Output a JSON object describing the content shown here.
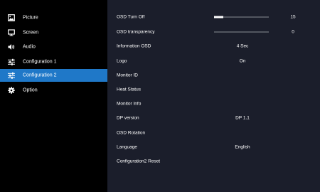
{
  "sidebar": {
    "items": [
      {
        "label": "Picture",
        "icon": "picture-icon",
        "selected": false
      },
      {
        "label": "Screen",
        "icon": "monitor-icon",
        "selected": false
      },
      {
        "label": "Audio",
        "icon": "speaker-icon",
        "selected": false
      },
      {
        "label": "Configuration 1",
        "icon": "sliders-icon",
        "selected": false
      },
      {
        "label": "Configuration 2",
        "icon": "sliders-icon",
        "selected": true
      },
      {
        "label": "Option",
        "icon": "gear-icon",
        "selected": false
      }
    ],
    "selected_color": "#1f78c8"
  },
  "panel": {
    "background": "#1b1e2b",
    "rows": [
      {
        "label": "OSD Turn Off",
        "type": "slider",
        "value": "15",
        "fraction": 0.17
      },
      {
        "label": "OSD transparency",
        "type": "slider",
        "value": "0",
        "fraction": 0
      },
      {
        "label": "Information OSD",
        "type": "value",
        "value": "4 Sec"
      },
      {
        "label": "Logo",
        "type": "value",
        "value": "On"
      },
      {
        "label": "Monitor ID",
        "type": "link",
        "value": ""
      },
      {
        "label": "Heat Status",
        "type": "link",
        "value": ""
      },
      {
        "label": "Monitor Info",
        "type": "link",
        "value": ""
      },
      {
        "label": "DP version",
        "type": "value",
        "value": "DP 1.1"
      },
      {
        "label": "OSD Rotation",
        "type": "link",
        "value": ""
      },
      {
        "label": "Language",
        "type": "value",
        "value": "English"
      },
      {
        "label": "Configuration2 Reset",
        "type": "link",
        "value": ""
      }
    ]
  }
}
